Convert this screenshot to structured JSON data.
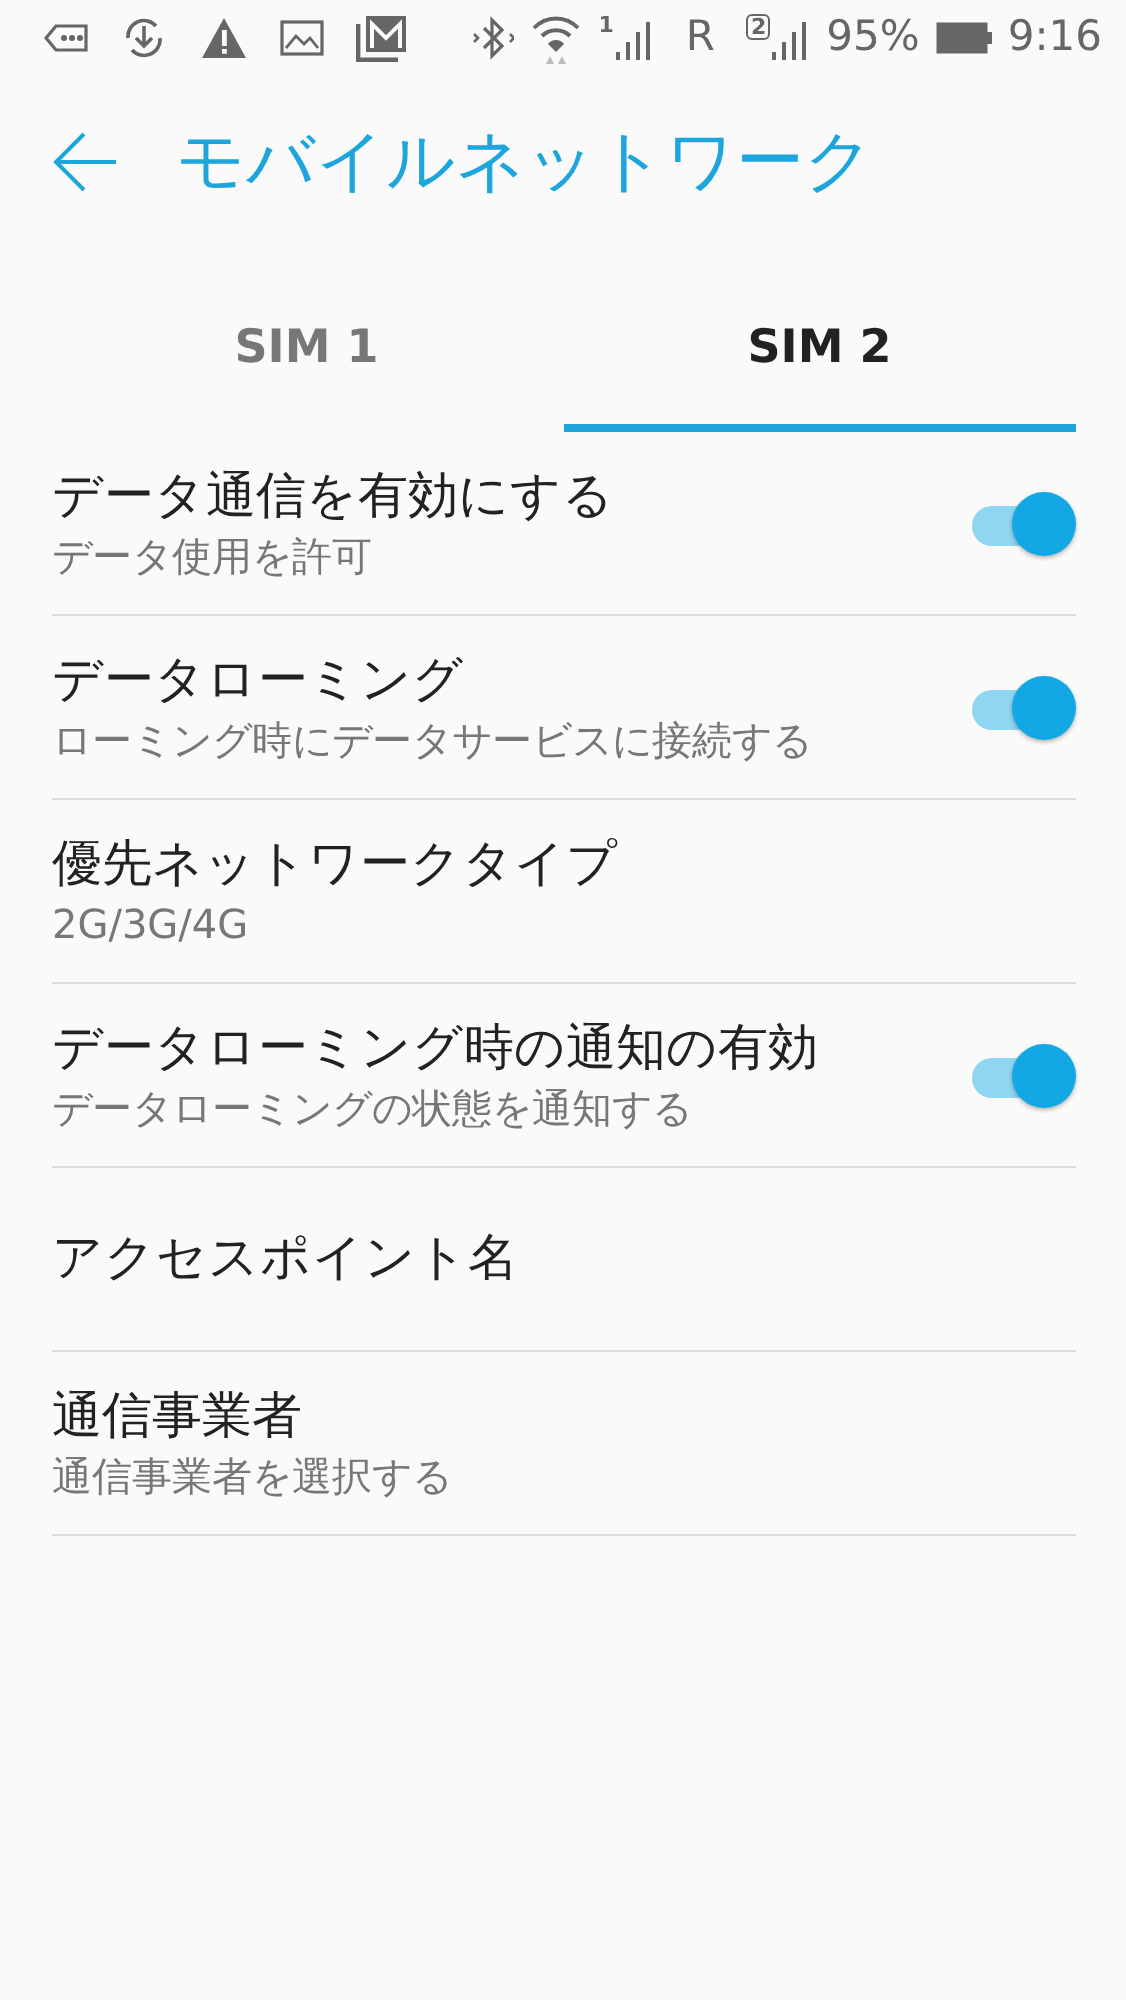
{
  "status_bar": {
    "sim1_label": "1",
    "roaming": "R",
    "sim2_label": "2",
    "battery": "95%",
    "time": "9:16"
  },
  "header": {
    "title": "モバイルネットワーク"
  },
  "tabs": [
    {
      "label": "SIM 1",
      "selected": false
    },
    {
      "label": "SIM 2",
      "selected": true
    }
  ],
  "settings": [
    {
      "kind": "toggle",
      "title": "データ通信を有効にする",
      "summary": "データ使用を許可",
      "on": true
    },
    {
      "kind": "toggle",
      "title": "データローミング",
      "summary": "ローミング時にデータサービスに接続する",
      "on": true
    },
    {
      "kind": "plain",
      "title": "優先ネットワークタイプ",
      "summary": "2G/3G/4G"
    },
    {
      "kind": "toggle",
      "title": "データローミング時の通知の有効",
      "summary": "データローミングの状態を通知する",
      "on": true
    },
    {
      "kind": "plain",
      "title": "アクセスポイント名"
    },
    {
      "kind": "plain",
      "title": "通信事業者",
      "summary": "通信事業者を選択する"
    }
  ]
}
